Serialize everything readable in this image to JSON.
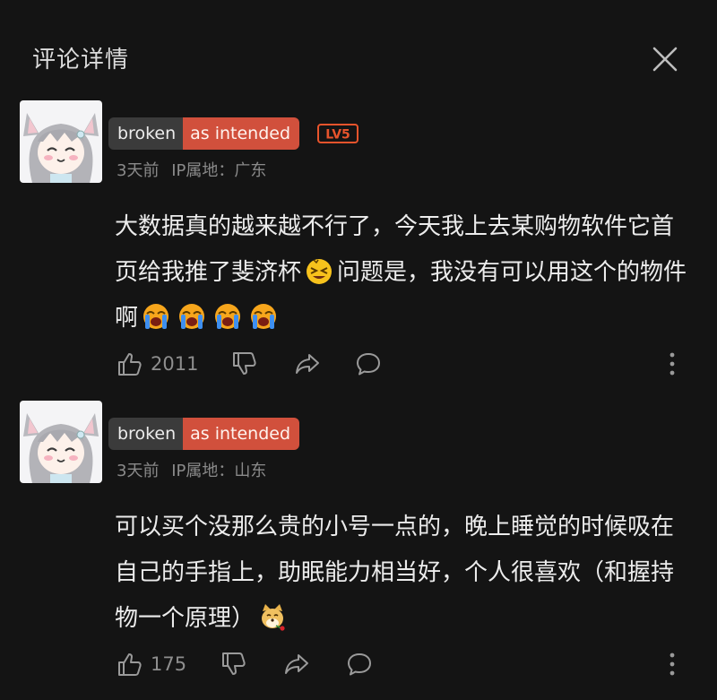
{
  "header": {
    "title": "评论详情"
  },
  "comments": [
    {
      "badge_left": "broken",
      "badge_right": "as intended",
      "level": "LV5",
      "time": "3天前",
      "ip": "IP属地：广东",
      "text_parts": [
        "大数据真的越来越不行了，今天我上去某购物软件它首页给我推了斐济杯",
        "问题是，我没有可以用这个的物件啊"
      ],
      "like_count": "2011"
    },
    {
      "badge_left": "broken",
      "badge_right": "as intended",
      "time": "3天前",
      "ip": "IP属地：山东",
      "text": "可以买个没那么贵的小号一点的，晚上睡觉的时候吸在自己的手指上，助眠能力相当好，个人很喜欢（和握持物一个原理）",
      "like_count": "175"
    }
  ],
  "colors": {
    "background": "#141414",
    "badge_accent": "#d1503c",
    "level": "#e8542c"
  },
  "icons": [
    "close-icon",
    "thumbs-up-icon",
    "thumbs-down-icon",
    "share-icon",
    "reply-bubble-icon",
    "more-vertical-icon"
  ]
}
